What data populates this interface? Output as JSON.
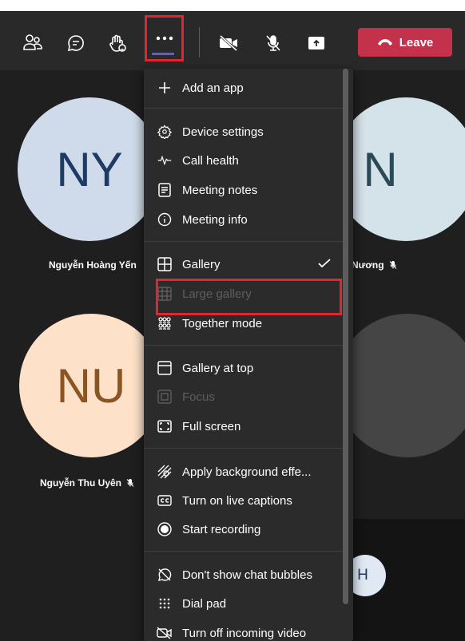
{
  "toolbar": {
    "leave_label": "Leave",
    "icons": [
      "participants-icon",
      "chat-icon",
      "raise-hand-icon",
      "more-actions-icon",
      "camera-off-icon",
      "mic-off-icon",
      "share-icon",
      "phone-hangup-icon"
    ]
  },
  "participants": [
    {
      "initials": "NY",
      "name": "Nguyễn Hoàng Yến"
    },
    {
      "initials": "N",
      "name": "Nương"
    },
    {
      "initials": "NU",
      "name": "Nguyễn Thu Uyên"
    },
    {
      "initials": "",
      "name": ""
    },
    {
      "initials": "H",
      "name": ""
    }
  ],
  "menu": {
    "items": [
      {
        "label": "Add an app"
      },
      {
        "label": "Device settings"
      },
      {
        "label": "Call health"
      },
      {
        "label": "Meeting notes"
      },
      {
        "label": "Meeting info"
      },
      {
        "label": "Gallery",
        "checked": true
      },
      {
        "label": "Large gallery",
        "disabled": true
      },
      {
        "label": "Together mode"
      },
      {
        "label": "Gallery at top"
      },
      {
        "label": "Focus",
        "disabled": true
      },
      {
        "label": "Full screen"
      },
      {
        "label": "Apply background effe..."
      },
      {
        "label": "Turn on live captions"
      },
      {
        "label": "Start recording"
      },
      {
        "label": "Don't show chat bubbles"
      },
      {
        "label": "Dial pad"
      },
      {
        "label": "Turn off incoming video"
      }
    ]
  },
  "colors": {
    "leave": "#c4314b",
    "highlight_box": "#e0262e",
    "menu_bg": "#2b2b2b",
    "disabled_text": "#5e5e5e"
  }
}
